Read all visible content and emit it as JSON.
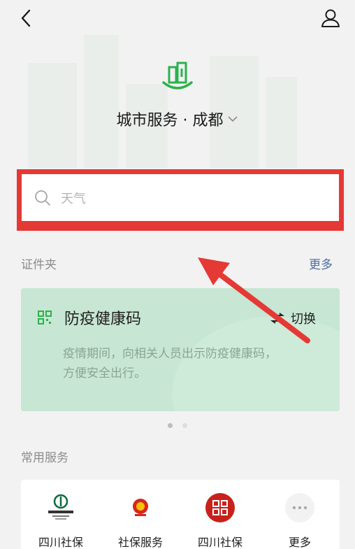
{
  "header": {
    "city_title": "城市服务 · 成都"
  },
  "search": {
    "placeholder": "天气"
  },
  "documents_section": {
    "title": "证件夹",
    "more_label": "更多"
  },
  "health_card": {
    "title": "防疫健康码",
    "switch_label": "切换",
    "description": "疫情期间，向相关人员出示防疫健康码，方便安全出行。"
  },
  "carousel": {
    "page_count": 2,
    "active_index": 0
  },
  "services_section": {
    "title": "常用服务"
  },
  "services": [
    {
      "label": "四川社保",
      "icon": "agricultural-bank-logo-icon"
    },
    {
      "label": "社保服务",
      "icon": "national-emblem-icon"
    },
    {
      "label": "四川社保",
      "icon": "red-seal-icon"
    },
    {
      "label": "更多",
      "icon": "more-dots-icon"
    }
  ],
  "colors": {
    "accent_green": "#2bb24c",
    "highlight_red": "#e53935",
    "card_green": "#c7e6d3",
    "link_blue": "#4a6fa5"
  }
}
